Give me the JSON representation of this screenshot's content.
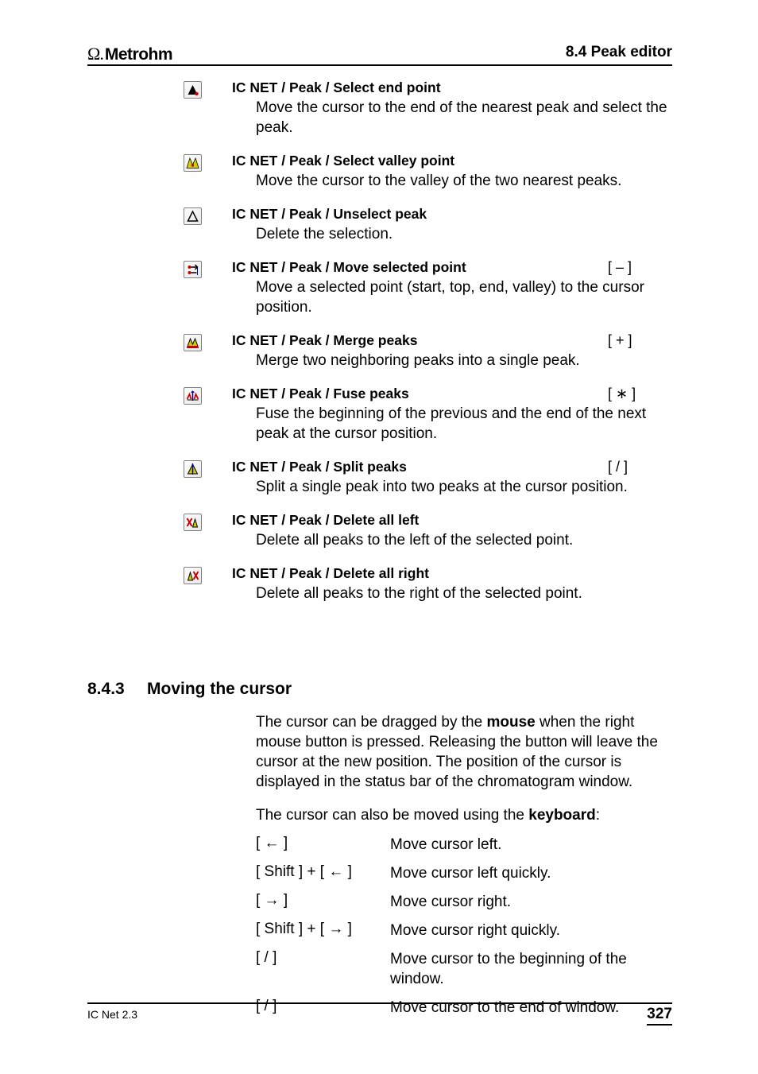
{
  "header": {
    "brand_symbol": "Ω.",
    "brand_name": "Metrohm",
    "right": "8.4  Peak editor"
  },
  "entries": [
    {
      "icon": "select-end-point-icon",
      "path": "IC NET / Peak / Select end point",
      "shortcut": "",
      "desc": "Move the cursor to the end of the nearest peak and select the peak."
    },
    {
      "icon": "select-valley-point-icon",
      "path": "IC NET / Peak / Select valley point",
      "shortcut": "",
      "desc": "Move the cursor to the valley of the two nearest peaks."
    },
    {
      "icon": "unselect-peak-icon",
      "path": "IC NET / Peak / Unselect peak",
      "shortcut": "",
      "desc": "Delete the selection."
    },
    {
      "icon": "move-selected-point-icon",
      "path": "IC NET / Peak / Move selected point",
      "shortcut": "[ – ]",
      "desc": "Move a selected point (start, top, end, valley) to the cursor position."
    },
    {
      "icon": "merge-peaks-icon",
      "path": "IC NET / Peak / Merge peaks",
      "shortcut": "[ + ]",
      "desc": "Merge two neighboring peaks into a single peak."
    },
    {
      "icon": "fuse-peaks-icon",
      "path": "IC NET / Peak / Fuse peaks",
      "shortcut": "[ ∗ ]",
      "desc": "Fuse the beginning of the previous and the end of the next peak at the cursor position."
    },
    {
      "icon": "split-peaks-icon",
      "path": "IC NET / Peak / Split peaks",
      "shortcut": "[ / ]",
      "desc": "Split a single peak into two peaks at the cursor position."
    },
    {
      "icon": "delete-all-left-icon",
      "path": "IC NET / Peak / Delete all left",
      "shortcut": "",
      "desc": "Delete all peaks to the left of the selected point."
    },
    {
      "icon": "delete-all-right-icon",
      "path": "IC NET / Peak / Delete all right",
      "shortcut": "",
      "desc": "Delete all peaks to the right of the selected point."
    }
  ],
  "section": {
    "number": "8.4.3",
    "title": "Moving the cursor",
    "para1_pre": "The cursor can be dragged by the ",
    "para1_bold1": "mouse",
    "para1_post1": " when the right mouse button is pressed. Releasing the button will leave the cursor at the new position. The position of the cursor is displayed in the status bar of the chromatogram window.",
    "para2_pre": "The cursor can also be moved using the ",
    "para2_bold": "keyboard",
    "para2_post": ":",
    "keys": [
      {
        "k": "[ ← ]",
        "d": "Move cursor left."
      },
      {
        "k": "[ Shift ] + [ ← ]",
        "d": "Move cursor left quickly."
      },
      {
        "k": "[ → ]",
        "d": "Move cursor right."
      },
      {
        "k": "[ Shift ] + [ → ]",
        "d": "Move cursor right quickly."
      },
      {
        "k": "[ / ]",
        "d": "Move cursor to the beginning of the window."
      },
      {
        "k": "[ / ]",
        "d": "Move cursor to the end of window."
      }
    ]
  },
  "footer": {
    "left": "IC Net 2.3",
    "right": "327"
  }
}
